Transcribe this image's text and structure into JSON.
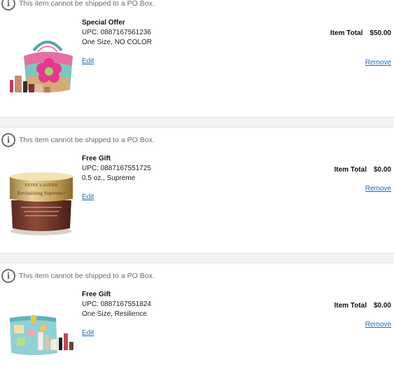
{
  "items": [
    {
      "notice": "This item cannot be shipped to a PO Box.",
      "name": "Special Offer",
      "upc": "UPC: 0887167561236",
      "variant": "One Size, NO COLOR",
      "edit_label": "Edit",
      "total_label": "Item Total",
      "total_value": "$50.00",
      "remove_label": "Remove"
    },
    {
      "notice": "This item cannot be shipped to a PO Box.",
      "name": "Free Gift",
      "upc": "UPC: 0887167551725",
      "variant": "0.5 oz., Supreme",
      "edit_label": "Edit",
      "total_label": "Item Total",
      "total_value": "$0.00",
      "remove_label": "Remove",
      "image_brand_text": "ESTEE LAUDER",
      "image_product_text": "Revitalizing Supreme+"
    },
    {
      "notice": "This item cannot be shipped to a PO Box.",
      "name": "Free Gift",
      "upc": "UPC: 0887167551824",
      "variant": "One Size, Resilience",
      "edit_label": "Edit",
      "total_label": "Item Total",
      "total_value": "$0.00",
      "remove_label": "Remove"
    }
  ],
  "icons": {
    "notice_icon": "info-circle-icon",
    "info_glyph": "i"
  },
  "colors": {
    "link": "#1e6bb8",
    "notice_text": "#6a6a6a",
    "divider": "#f2f2f2"
  }
}
